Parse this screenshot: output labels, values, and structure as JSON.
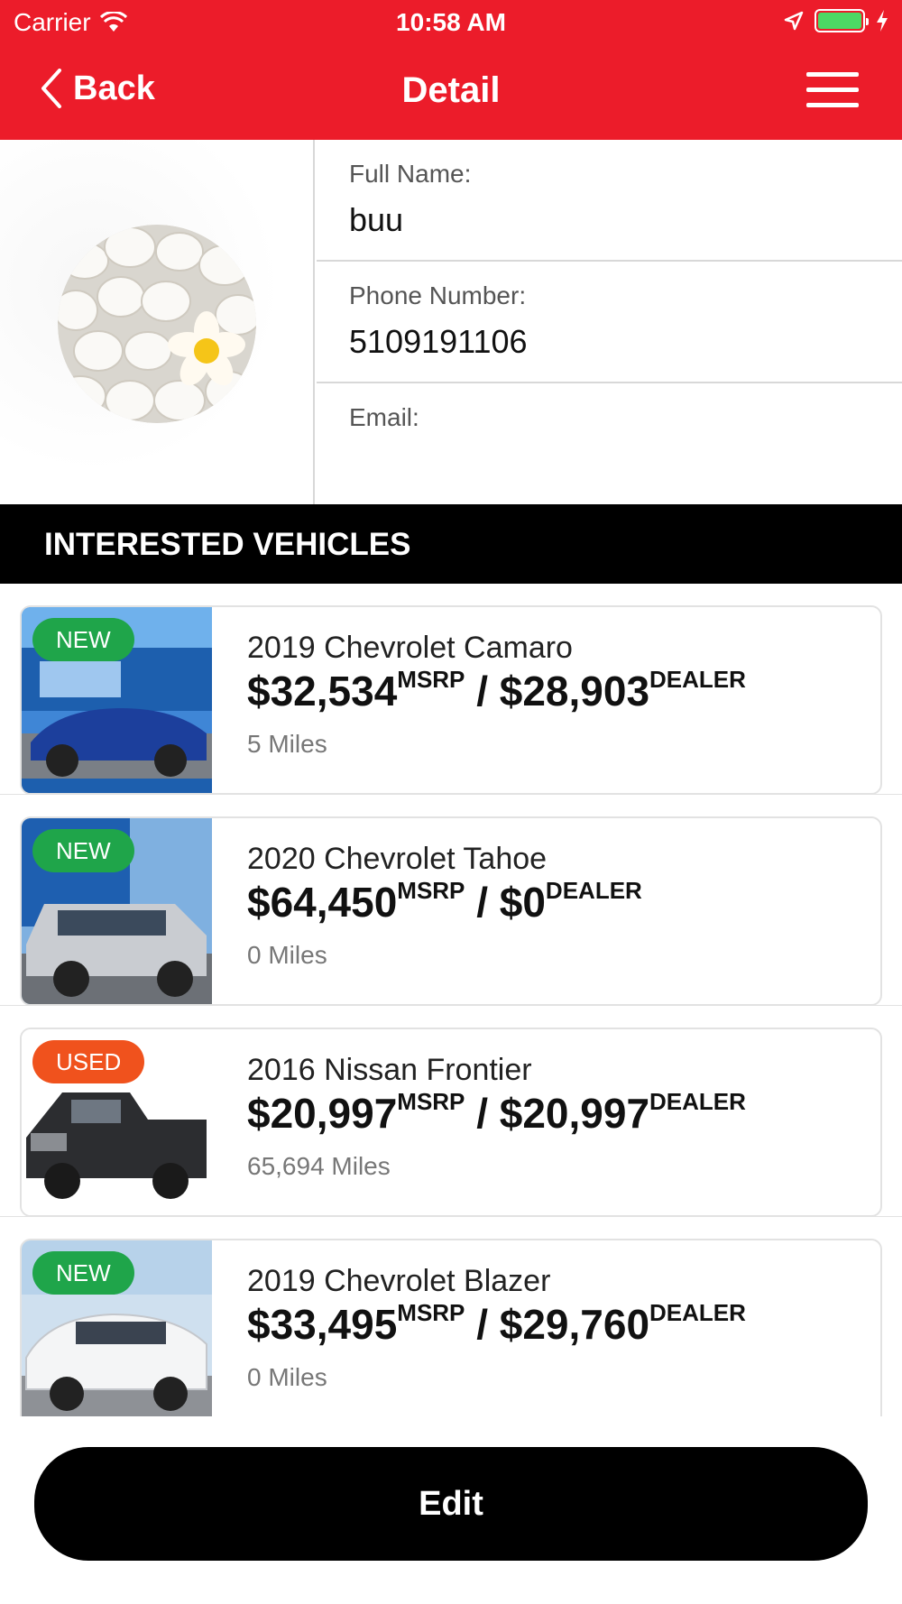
{
  "status_bar": {
    "carrier": "Carrier",
    "time": "10:58 AM"
  },
  "nav": {
    "back_label": "Back",
    "title": "Detail"
  },
  "colors": {
    "accent": "#ec1c2a",
    "new_badge": "#1fa54a",
    "used_badge": "#f0521d"
  },
  "profile": {
    "full_name_label": "Full Name:",
    "full_name": "buu",
    "phone_label": "Phone Number:",
    "phone": "5109191106",
    "email_label": "Email:",
    "email": ""
  },
  "section_title": "INTERESTED VEHICLES",
  "vehicles": [
    {
      "badge": "NEW",
      "title": "2019 Chevrolet Camaro",
      "msrp": "$32,534",
      "msrp_label": "MSRP",
      "separator": "/",
      "dealer": "$28,903",
      "dealer_label": "DEALER",
      "miles": "5 Miles"
    },
    {
      "badge": "NEW",
      "title": "2020 Chevrolet Tahoe",
      "msrp": "$64,450",
      "msrp_label": "MSRP",
      "separator": "/",
      "dealer": "$0",
      "dealer_label": "DEALER",
      "miles": "0 Miles"
    },
    {
      "badge": "USED",
      "title": "2016 Nissan Frontier",
      "msrp": "$20,997",
      "msrp_label": "MSRP",
      "separator": "/",
      "dealer": "$20,997",
      "dealer_label": "DEALER",
      "miles": "65,694 Miles"
    },
    {
      "badge": "NEW",
      "title": "2019 Chevrolet Blazer",
      "msrp": "$33,495",
      "msrp_label": "MSRP",
      "separator": "/",
      "dealer": "$29,760",
      "dealer_label": "DEALER",
      "miles": "0 Miles"
    }
  ],
  "edit_label": "Edit"
}
